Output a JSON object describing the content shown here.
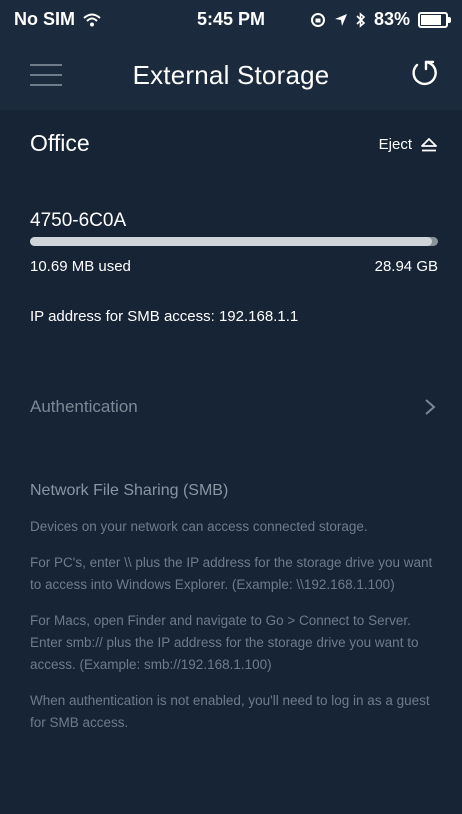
{
  "status_bar": {
    "carrier": "No SIM",
    "time": "5:45 PM",
    "battery": "83%",
    "battery_fraction": 0.83
  },
  "nav": {
    "title": "External Storage"
  },
  "device": {
    "name": "Office",
    "eject_label": "Eject"
  },
  "storage": {
    "label": "4750-6C0A",
    "used": "10.69 MB used",
    "total": "28.94 GB",
    "used_fraction": 0.985,
    "ip_text": "IP address for SMB access: 192.168.1.1"
  },
  "auth": {
    "label": "Authentication"
  },
  "smb": {
    "title": "Network File Sharing (SMB)",
    "para1": "Devices on your network can access connected storage.",
    "para2": "For PC's, enter \\\\ plus the IP address for the storage drive you want to access into Windows Explorer. (Example: \\\\192.168.1.100)",
    "para3": "For Macs, open Finder and navigate to Go > Connect to Server. Enter smb:// plus the IP address for the storage drive you want to access. (Example: smb://192.168.1.100)",
    "para4": "When authentication is not enabled, you'll need to log in as a guest for SMB access."
  }
}
